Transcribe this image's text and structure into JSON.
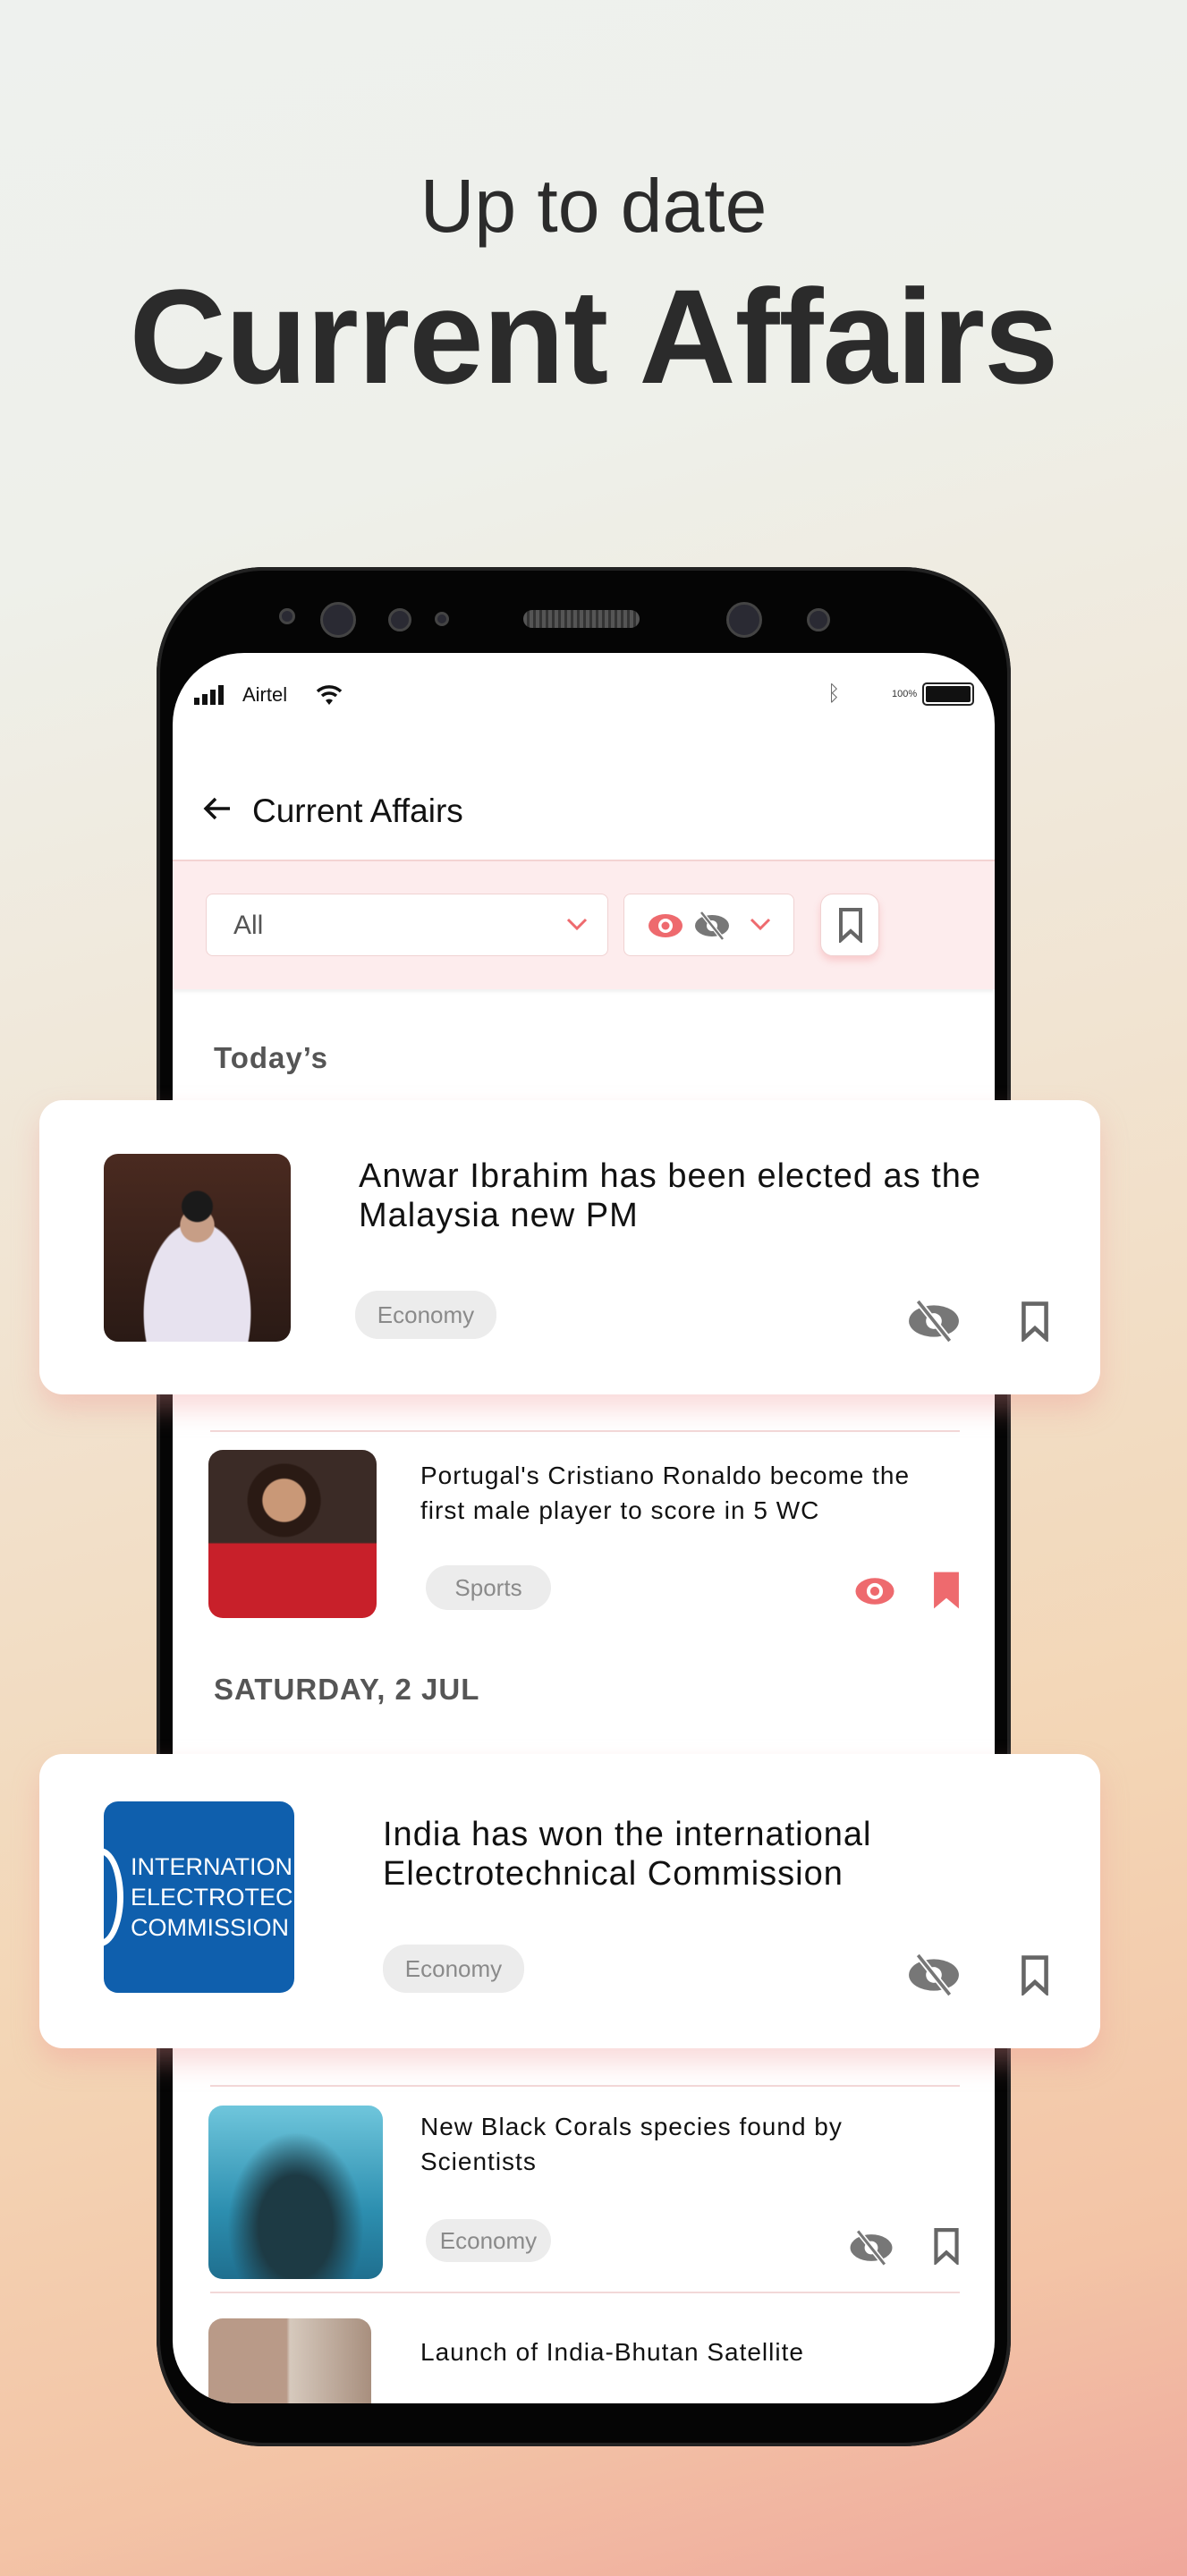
{
  "hero": {
    "subtitle": "Up to date",
    "title": "Current Affairs"
  },
  "status_bar": {
    "carrier": "Airtel",
    "battery": "100%"
  },
  "header": {
    "title": "Current Affairs"
  },
  "filters": {
    "category": "All"
  },
  "colors": {
    "accent": "#ee6a6e",
    "band": "#fdeced",
    "tag_bg": "#ececec"
  },
  "sections": [
    {
      "label": "Today’s"
    },
    {
      "label": "SATURDAY, 2 JUL"
    }
  ],
  "items": [
    {
      "title": "Anwar Ibrahim has been elected as the Malaysia new PM",
      "tag": "Economy",
      "viewed": false,
      "bookmarked": false
    },
    {
      "title": "Portugal's Cristiano Ronaldo become the first male player to score in 5 WC",
      "tag": "Sports",
      "viewed": true,
      "bookmarked": true
    },
    {
      "title": "India has won the international Electrotechnical Commission",
      "tag": "Economy",
      "viewed": false,
      "bookmarked": false,
      "logo_text": [
        "INTERNATION",
        "ELECTROTEC",
        "COMMISSION"
      ]
    },
    {
      "title": "New Black Corals species found by Scientists",
      "tag": "Economy",
      "viewed": false,
      "bookmarked": false
    },
    {
      "title": "Launch of India-Bhutan Satellite"
    }
  ]
}
